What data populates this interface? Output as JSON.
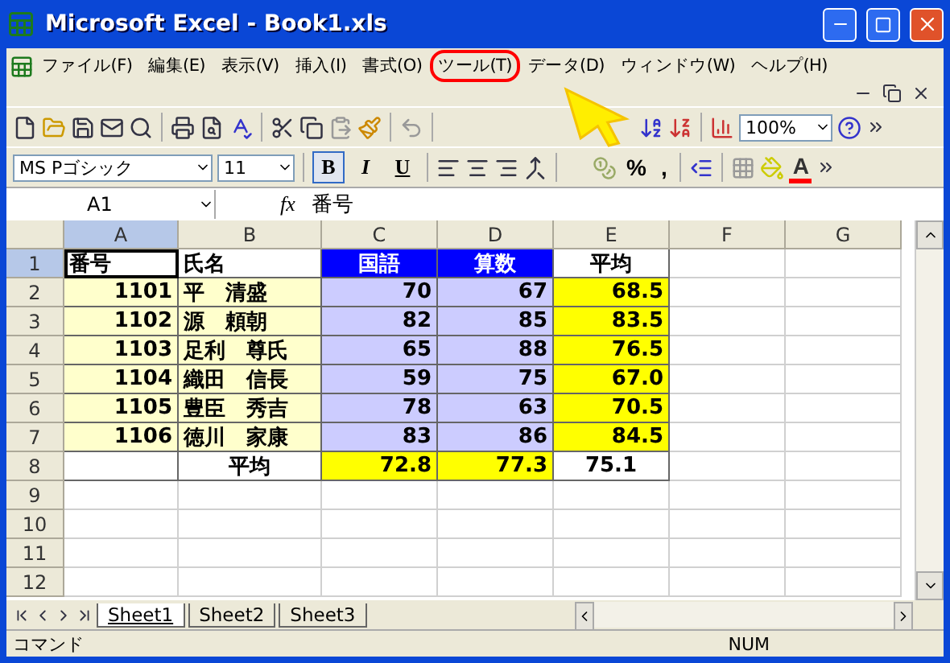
{
  "window": {
    "title": "Microsoft Excel - Book1.xls"
  },
  "menu": [
    {
      "label": "ファイル(F)",
      "highlighted": false
    },
    {
      "label": "編集(E)",
      "highlighted": false
    },
    {
      "label": "表示(V)",
      "highlighted": false
    },
    {
      "label": "挿入(I)",
      "highlighted": false
    },
    {
      "label": "書式(O)",
      "highlighted": false
    },
    {
      "label": "ツール(T)",
      "highlighted": true
    },
    {
      "label": "データ(D)",
      "highlighted": false
    },
    {
      "label": "ウィンドウ(W)",
      "highlighted": false
    },
    {
      "label": "ヘルプ(H)",
      "highlighted": false
    }
  ],
  "standard_toolbar": {
    "zoom": "100%"
  },
  "formatting_toolbar": {
    "font": "MS Pゴシック",
    "size": "11",
    "styles": [
      {
        "label": "B",
        "pressed": true
      },
      {
        "label": "I",
        "pressed": false
      },
      {
        "label": "U",
        "pressed": false
      }
    ],
    "percent": ",",
    "percent_label": "%",
    "font_color_label": "A"
  },
  "formula_bar": {
    "name_box": "A1",
    "fx": "fx",
    "formula": "番号"
  },
  "columns": [
    {
      "label": "A",
      "selected": true
    },
    {
      "label": "B",
      "selected": false
    },
    {
      "label": "C",
      "selected": false
    },
    {
      "label": "D",
      "selected": false
    },
    {
      "label": "E",
      "selected": false
    },
    {
      "label": "F",
      "selected": false
    },
    {
      "label": "G",
      "selected": false
    }
  ],
  "rows": [
    {
      "number": "1",
      "selected": true,
      "cells": [
        {
          "text": "番号",
          "color": "#ffffff",
          "kind": "text",
          "selected": true
        },
        {
          "text": "氏名",
          "color": "#ffffff",
          "kind": "text",
          "selected": false
        },
        {
          "text": "国語",
          "color": "#0000ff",
          "kind": "heading",
          "selected": false
        },
        {
          "text": "算数",
          "color": "#0000ff",
          "kind": "heading",
          "selected": false
        },
        {
          "text": "平均",
          "color": "#ffffff",
          "kind": "heading",
          "selected": false
        }
      ]
    },
    {
      "number": "2",
      "selected": false,
      "cells": [
        {
          "text": "1101",
          "color": "#ffffcc",
          "kind": "number",
          "selected": false
        },
        {
          "text": "平　清盛",
          "color": "#ffffcc",
          "kind": "text",
          "selected": false
        },
        {
          "text": "70",
          "color": "#ccccff",
          "kind": "number",
          "selected": false
        },
        {
          "text": "67",
          "color": "#ccccff",
          "kind": "number",
          "selected": false
        },
        {
          "text": "68.5",
          "color": "#ffff00",
          "kind": "number",
          "selected": false
        }
      ]
    },
    {
      "number": "3",
      "selected": false,
      "cells": [
        {
          "text": "1102",
          "color": "#ffffcc",
          "kind": "number",
          "selected": false
        },
        {
          "text": "源　頼朝",
          "color": "#ffffcc",
          "kind": "text",
          "selected": false
        },
        {
          "text": "82",
          "color": "#ccccff",
          "kind": "number",
          "selected": false
        },
        {
          "text": "85",
          "color": "#ccccff",
          "kind": "number",
          "selected": false
        },
        {
          "text": "83.5",
          "color": "#ffff00",
          "kind": "number",
          "selected": false
        }
      ]
    },
    {
      "number": "4",
      "selected": false,
      "cells": [
        {
          "text": "1103",
          "color": "#ffffcc",
          "kind": "number",
          "selected": false
        },
        {
          "text": "足利　尊氏",
          "color": "#ffffcc",
          "kind": "text",
          "selected": false
        },
        {
          "text": "65",
          "color": "#ccccff",
          "kind": "number",
          "selected": false
        },
        {
          "text": "88",
          "color": "#ccccff",
          "kind": "number",
          "selected": false
        },
        {
          "text": "76.5",
          "color": "#ffff00",
          "kind": "number",
          "selected": false
        }
      ]
    },
    {
      "number": "5",
      "selected": false,
      "cells": [
        {
          "text": "1104",
          "color": "#ffffcc",
          "kind": "number",
          "selected": false
        },
        {
          "text": "織田　信長",
          "color": "#ffffcc",
          "kind": "text",
          "selected": false
        },
        {
          "text": "59",
          "color": "#ccccff",
          "kind": "number",
          "selected": false
        },
        {
          "text": "75",
          "color": "#ccccff",
          "kind": "number",
          "selected": false
        },
        {
          "text": "67.0",
          "color": "#ffff00",
          "kind": "number",
          "selected": false
        }
      ]
    },
    {
      "number": "6",
      "selected": false,
      "cells": [
        {
          "text": "1105",
          "color": "#ffffcc",
          "kind": "number",
          "selected": false
        },
        {
          "text": "豊臣　秀吉",
          "color": "#ffffcc",
          "kind": "text",
          "selected": false
        },
        {
          "text": "78",
          "color": "#ccccff",
          "kind": "number",
          "selected": false
        },
        {
          "text": "63",
          "color": "#ccccff",
          "kind": "number",
          "selected": false
        },
        {
          "text": "70.5",
          "color": "#ffff00",
          "kind": "number",
          "selected": false
        }
      ]
    },
    {
      "number": "7",
      "selected": false,
      "cells": [
        {
          "text": "1106",
          "color": "#ffffcc",
          "kind": "number",
          "selected": false
        },
        {
          "text": "徳川　家康",
          "color": "#ffffcc",
          "kind": "text",
          "selected": false
        },
        {
          "text": "83",
          "color": "#ccccff",
          "kind": "number",
          "selected": false
        },
        {
          "text": "86",
          "color": "#ccccff",
          "kind": "number",
          "selected": false
        },
        {
          "text": "84.5",
          "color": "#ffff00",
          "kind": "number",
          "selected": false
        }
      ]
    },
    {
      "number": "8",
      "selected": false,
      "cells": [
        null,
        {
          "text": "平均",
          "color": "#ffffff",
          "kind": "heading",
          "selected": false
        },
        {
          "text": "72.8",
          "color": "#ffff00",
          "kind": "number",
          "selected": false
        },
        {
          "text": "77.3",
          "color": "#ffff00",
          "kind": "number",
          "selected": false
        },
        {
          "text": "75.1",
          "color": "#ffffff",
          "kind": "heading",
          "selected": false
        }
      ]
    },
    {
      "number": "9",
      "selected": false,
      "cells": []
    },
    {
      "number": "10",
      "selected": false,
      "cells": []
    },
    {
      "number": "11",
      "selected": false,
      "cells": []
    },
    {
      "number": "12",
      "selected": false,
      "cells": []
    }
  ],
  "sheet_tabs": [
    {
      "label": "Sheet1",
      "selected": true
    },
    {
      "label": "Sheet2",
      "selected": false
    },
    {
      "label": "Sheet3",
      "selected": false
    }
  ],
  "status_bar": {
    "mode": "コマンド",
    "num": "NUM"
  }
}
